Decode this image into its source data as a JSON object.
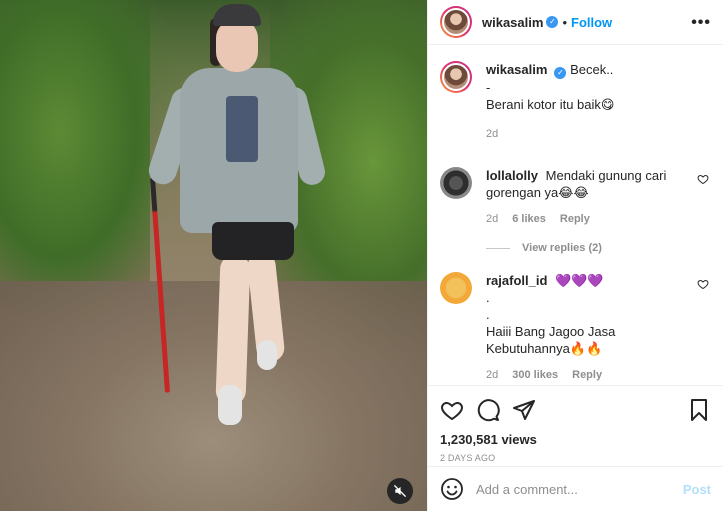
{
  "media": {
    "mute_icon": "speaker-muted-icon"
  },
  "header": {
    "username": "wikasalim",
    "separator": "•",
    "follow_label": "Follow",
    "more_label": "•••"
  },
  "caption": {
    "username": "wikasalim",
    "line1": "Becek..",
    "line2": "-",
    "line3": "Berani kotor itu baik😋",
    "time": "2d"
  },
  "comments": [
    {
      "username": "lollalolly",
      "text": "Mendaki gunung cari gorengan ya😂😂",
      "time": "2d",
      "likes": "6 likes",
      "reply_label": "Reply",
      "view_replies": "View replies (2)"
    },
    {
      "username": "rajafoll_id",
      "text_line1": "💜💜💜",
      "text_line2": ".",
      "text_line3": ".",
      "text_line4": "Haiii Bang Jagoo Jasa Kebutuhannya🔥🔥",
      "time": "2d",
      "likes": "300 likes",
      "reply_label": "Reply"
    }
  ],
  "stats": {
    "views": "1,230,581 views",
    "ago": "2 DAYS AGO"
  },
  "add_comment": {
    "placeholder": "Add a comment...",
    "post_label": "Post"
  },
  "colors": {
    "accent": "#0095f6",
    "verified": "#3897f0",
    "muted_text": "#8e8e8e"
  }
}
